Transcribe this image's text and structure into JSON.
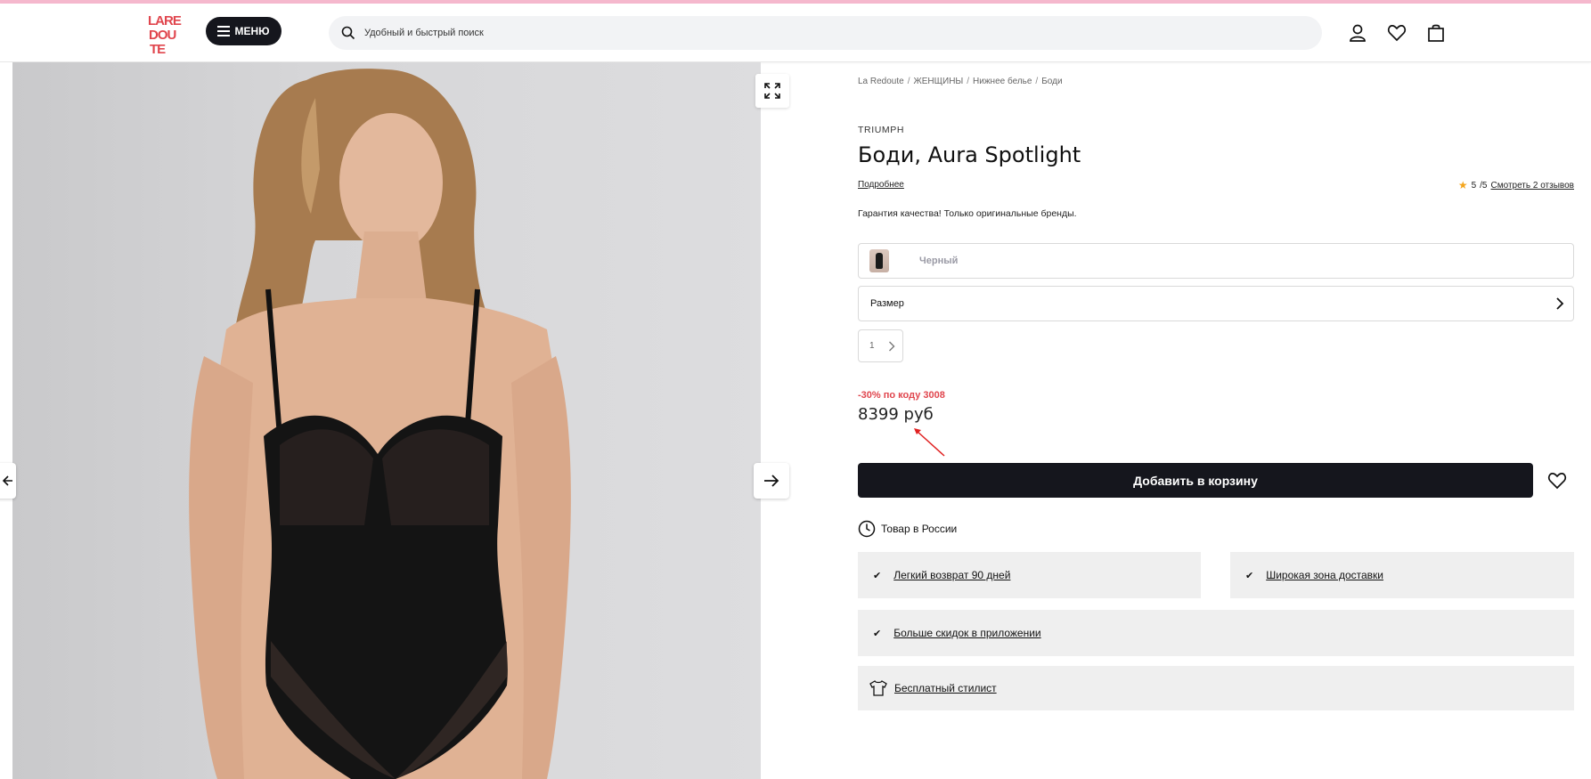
{
  "header": {
    "logo_text": "LA REDOUTE",
    "menu_label": "МЕНЮ",
    "search_placeholder": "Удобный и быстрый поиск",
    "icons": [
      "account-icon",
      "heart-icon",
      "bag-icon"
    ]
  },
  "breadcrumb": [
    "La Redoute",
    "ЖЕНЩИНЫ",
    "Нижнее белье",
    "Боди"
  ],
  "product": {
    "brand": "TRIUMPH",
    "title": "Боди, Aura Spotlight",
    "more_link": "Подробнее",
    "rating_value": "5",
    "rating_max": "/5",
    "reviews_link": "Смотреть 2 отзывов",
    "guarantee": "Гарантия качества! Только оригинальные бренды.",
    "color": "Черный",
    "size_label": "Размер",
    "quantity": "1",
    "promo": "-30% по коду 3008",
    "price": "8399 руб",
    "add_to_cart": "Добавить в корзину",
    "stock": "Товар в России"
  },
  "features": [
    {
      "label": "Легкий возврат 90 дней",
      "icon": "check-icon"
    },
    {
      "label": "Широкая зона доставки",
      "icon": "check-icon"
    },
    {
      "label": "Больше скидок в приложении",
      "icon": "check-icon"
    },
    {
      "label": "Бесплатный стилист",
      "icon": "tshirt-icon"
    }
  ],
  "colors": {
    "accent_pink": "#f5b8cd",
    "logo_red": "#e0454d",
    "promo_red": "#e0454d",
    "dark_button": "#15161d",
    "feature_bg": "#efefef"
  }
}
